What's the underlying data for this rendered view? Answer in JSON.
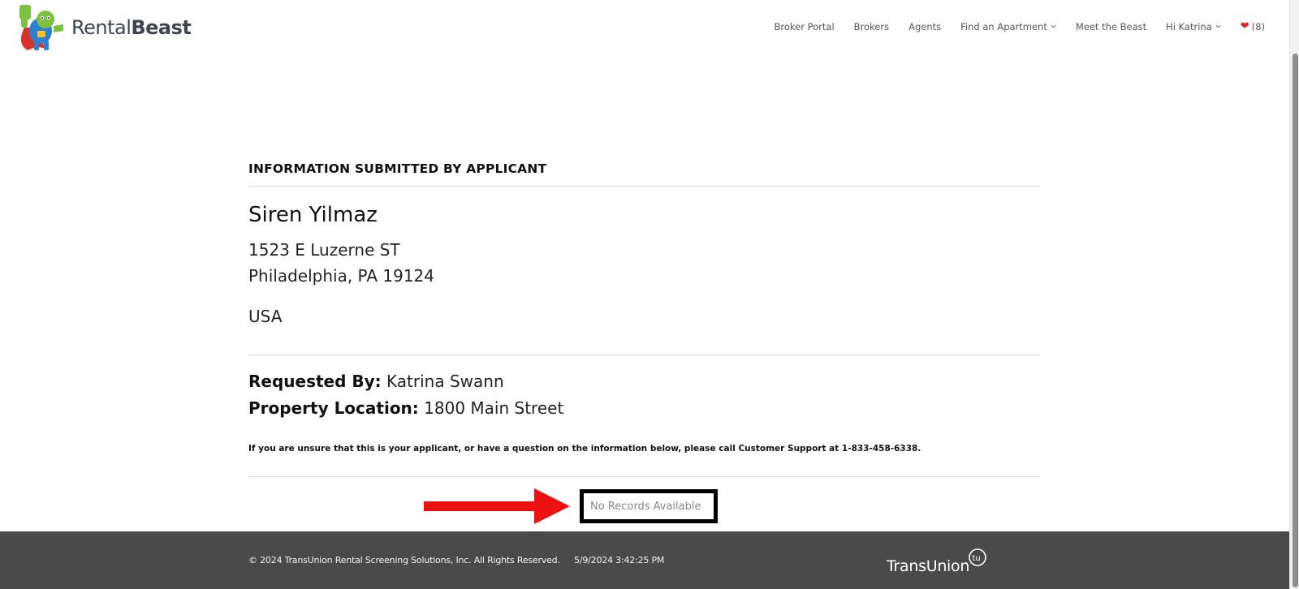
{
  "header": {
    "logo": {
      "word1": "Rental",
      "word2": "Beast",
      "icon": "superhero-mascot-icon"
    },
    "nav": [
      {
        "label": "Broker Portal",
        "dropdown": false
      },
      {
        "label": "Brokers",
        "dropdown": false
      },
      {
        "label": "Agents",
        "dropdown": false
      },
      {
        "label": "Find an Apartment",
        "dropdown": true
      },
      {
        "label": "Meet the Beast",
        "dropdown": false
      },
      {
        "label": "Hi Katrina",
        "dropdown": true
      }
    ],
    "favorites": {
      "icon": "heart-icon",
      "count_text": "(8)"
    }
  },
  "main": {
    "section_title": "INFORMATION SUBMITTED BY APPLICANT",
    "applicant": {
      "name": "Siren Yilmaz",
      "street": "1523 E Luzerne ST",
      "city_state_zip": "Philadelphia, PA 19124",
      "country": "USA"
    },
    "requested_by": {
      "label": "Requested By:",
      "value": "Katrina Swann"
    },
    "property_location": {
      "label": "Property Location:",
      "value": "1800 Main Street"
    },
    "notice": "If you are unsure that this is your applicant, or have a question on the information below, please call Customer Support at 1-833-458-6338.",
    "records_status": "No Records Available"
  },
  "annotation": {
    "arrow_color": "#ee1111",
    "box_color": "#000000"
  },
  "footer": {
    "copyright": "© 2024 TransUnion Rental Screening Solutions, Inc. All Rights Reserved.",
    "timestamp": "5/9/2024 3:42:25 PM",
    "brand": "TransUnion",
    "brand_mark": "tu-logo-icon"
  },
  "colors": {
    "footer_bg": "#4a4a4a",
    "heart": "#e02020",
    "accent_green": "#7dc142"
  }
}
